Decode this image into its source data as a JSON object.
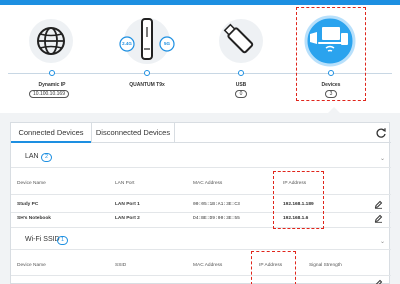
{
  "colors": {
    "accent": "#1d8fe1",
    "highlight": "#e0251b",
    "band": "#f1f3f5"
  },
  "topology": {
    "nodes": [
      {
        "id": "internet",
        "icon": "globe-icon",
        "label": "Dynamic IP",
        "pill": "10.100.10.169"
      },
      {
        "id": "router",
        "icon": "router-icon",
        "label": "QUANTUM T9x",
        "pill": "",
        "band_24": "2.4G",
        "band_5": "5G"
      },
      {
        "id": "usb",
        "icon": "usb-drive-icon",
        "label": "USB",
        "pill": "0"
      },
      {
        "id": "devices",
        "icon": "devices-icon",
        "label": "Devices",
        "pill": "3"
      }
    ]
  },
  "tabs": [
    {
      "label": "Connected Devices",
      "active": true
    },
    {
      "label": "Disconnected Devices",
      "active": false
    }
  ],
  "lan": {
    "title": "LAN",
    "count": "2",
    "columns": [
      "Device Name",
      "LAN Port",
      "MAC Address",
      "IP Address"
    ],
    "rows": [
      {
        "name": "Study PC",
        "port": "LAN Port 1",
        "mac": "00:05:1B:A1:3E:C3",
        "ip": "192.168.1.189"
      },
      {
        "name": "SH's Notebook",
        "port": "LAN Port 2",
        "mac": "D4:BE:D9:00:3E:55",
        "ip": "192.168.1.6"
      }
    ]
  },
  "wifi": {
    "title": "Wi-Fi SSID",
    "count": "1",
    "columns": [
      "Device Name",
      "SSID",
      "MAC Address",
      "IP Address",
      "Signal Strength"
    ]
  }
}
